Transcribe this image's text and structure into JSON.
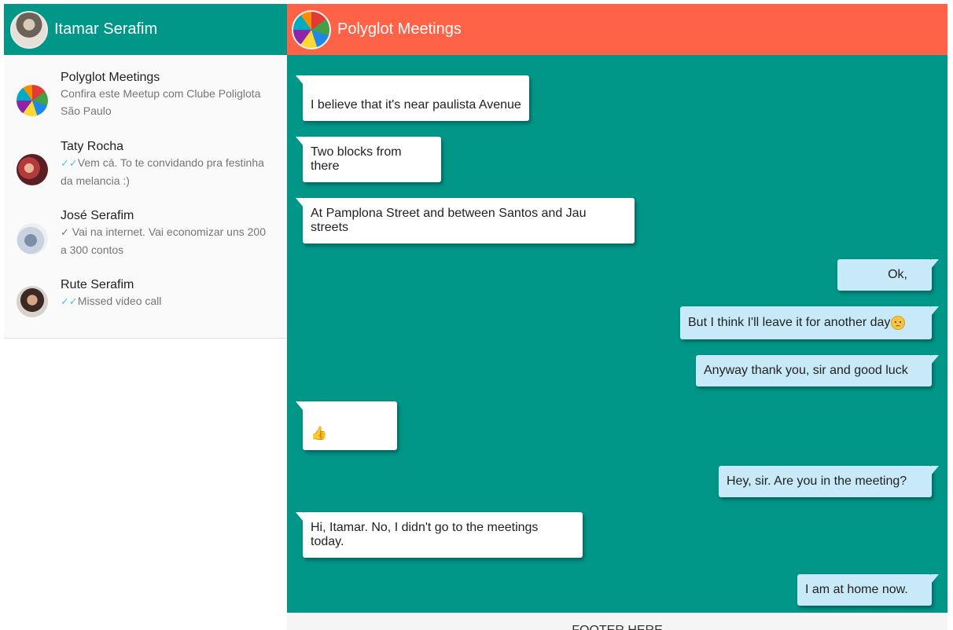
{
  "user": {
    "name": "Itamar Serafim"
  },
  "contacts": [
    {
      "name": "Polyglot Meetings",
      "tick": "",
      "message": "Confira este Meetup com Clube Poliglota São Paulo"
    },
    {
      "name": "Taty Rocha",
      "tick": "✓✓",
      "message": "Vem cá. To te convidando pra festinha da melancia :)"
    },
    {
      "name": "José Serafim",
      "tick": "✓",
      "message": " Vai na internet. Vai economizar uns 200 a 300 contos"
    },
    {
      "name": "Rute Serafim",
      "tick": "✓✓",
      "message": "Missed video call"
    }
  ],
  "chat": {
    "title": "Polyglot Meetings",
    "messages": [
      {
        "dir": "in",
        "text": "I believe that it's near paulista Avenue"
      },
      {
        "dir": "in",
        "text": "Two blocks from there"
      },
      {
        "dir": "in",
        "text": "At Pamplona Street and between Santos and Jau streets"
      },
      {
        "dir": "out",
        "text": "Ok,"
      },
      {
        "dir": "out",
        "text": "But I think I'll leave it for another day",
        "emoji": "disappointed-face"
      },
      {
        "dir": "out",
        "text": "Anyway thank you, sir and good luck"
      },
      {
        "dir": "in",
        "text": "👍"
      },
      {
        "dir": "out",
        "text": "Hey, sir. Are you in the meeting?"
      },
      {
        "dir": "in",
        "text": "Hi, Itamar. No, I didn't go to the meetings today."
      },
      {
        "dir": "out",
        "text": "I am at home now."
      }
    ]
  },
  "footer": {
    "text": "FOOTER HERE"
  },
  "colors": {
    "primary": "#009688",
    "chat_header": "#ff6347",
    "incoming": "#ffffff",
    "outgoing": "#c8eaf8",
    "tick_read": "#4fc3f7"
  }
}
